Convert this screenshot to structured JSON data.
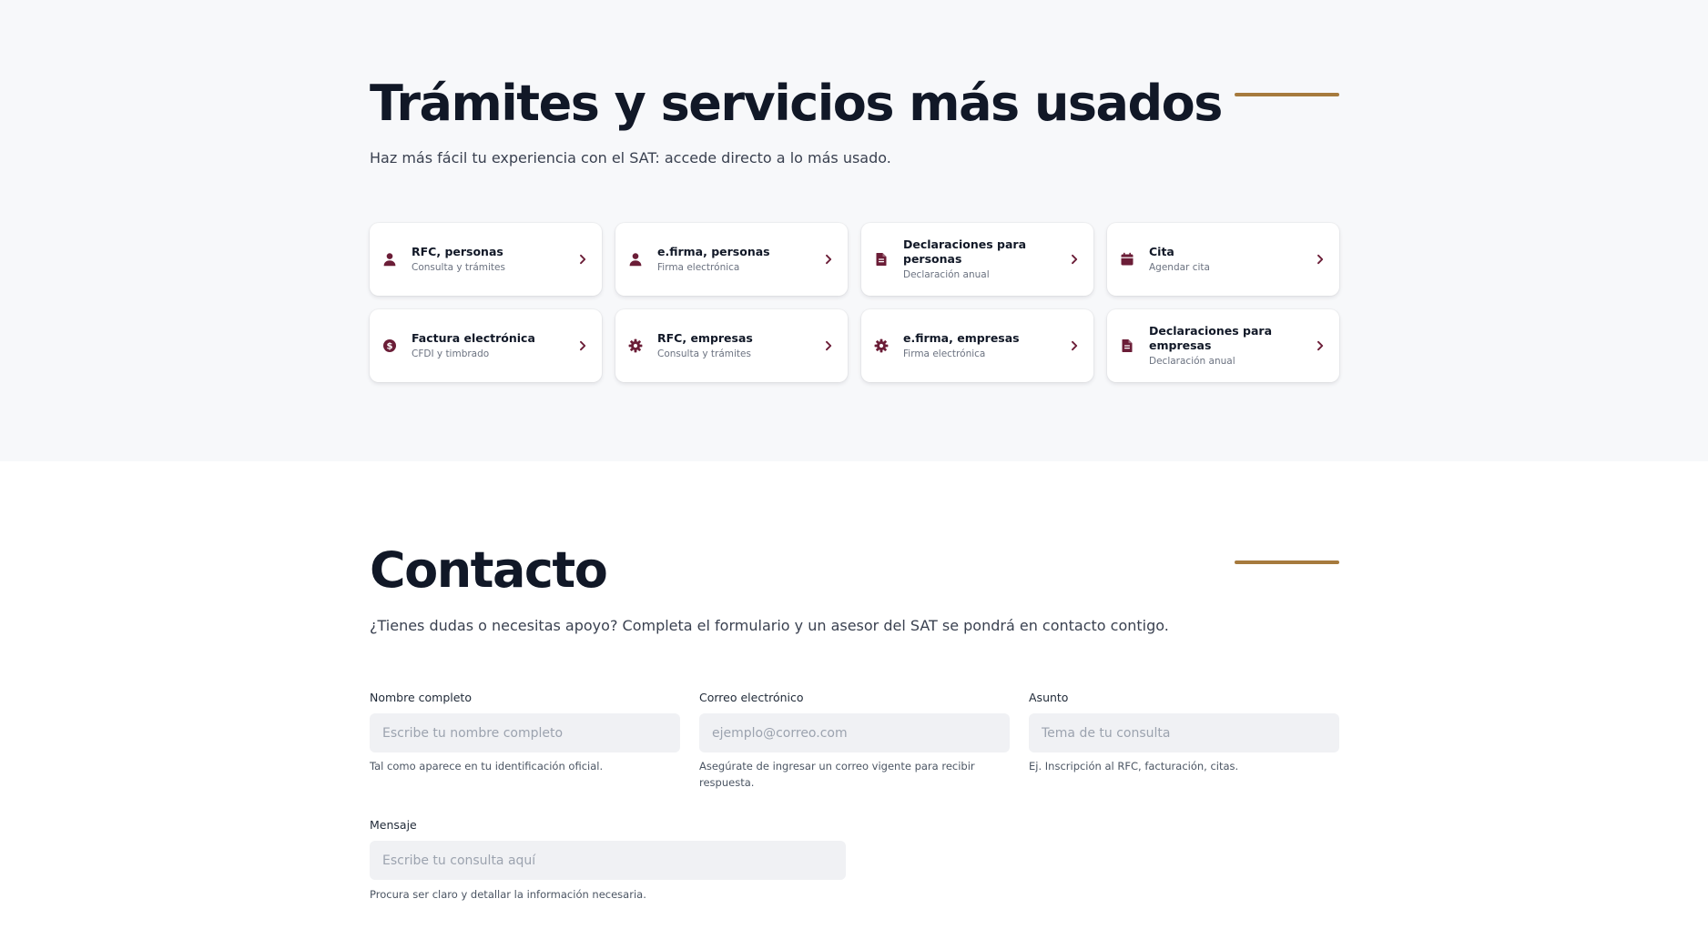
{
  "services": {
    "title": "Trámites y servicios más usados",
    "subtitle": "Haz más fácil tu experiencia con el SAT: accede directo a lo más usado.",
    "cards": [
      {
        "title": "RFC, personas",
        "subtitle": "Consulta y trámites",
        "icon": "person-icon"
      },
      {
        "title": "e.firma, personas",
        "subtitle": "Firma electrónica",
        "icon": "person-icon"
      },
      {
        "title": "Declaraciones para personas",
        "subtitle": "Declaración anual",
        "icon": "document-icon"
      },
      {
        "title": "Cita",
        "subtitle": "Agendar cita",
        "icon": "calendar-icon"
      },
      {
        "title": "Factura electrónica",
        "subtitle": "CFDI y timbrado",
        "icon": "dollar-circle-icon"
      },
      {
        "title": "RFC, empresas",
        "subtitle": "Consulta y trámites",
        "icon": "gear-icon"
      },
      {
        "title": "e.firma, empresas",
        "subtitle": "Firma electrónica",
        "icon": "gear-icon"
      },
      {
        "title": "Declaraciones para empresas",
        "subtitle": "Declaración anual",
        "icon": "document-icon"
      }
    ]
  },
  "contact": {
    "title": "Contacto",
    "subtitle": "¿Tienes dudas o necesitas apoyo? Completa el formulario y un asesor del SAT se pondrá en contacto contigo.",
    "fields": {
      "name": {
        "label": "Nombre completo",
        "placeholder": "Escribe tu nombre completo",
        "value": "",
        "help": "Tal como aparece en tu identificación oficial."
      },
      "email": {
        "label": "Correo electrónico",
        "placeholder": "ejemplo@correo.com",
        "value": "",
        "help": "Asegúrate de ingresar un correo vigente para recibir respuesta."
      },
      "subject": {
        "label": "Asunto",
        "placeholder": "Tema de tu consulta",
        "value": "",
        "help": "Ej. Inscripción al RFC, facturación, citas."
      },
      "message": {
        "label": "Mensaje",
        "placeholder": "Escribe tu consulta aquí",
        "value": "",
        "help": "Procura ser claro y detallar la información necesaria."
      }
    }
  },
  "colors": {
    "accent_line": "#a67a3d",
    "icon": "#6b1d37",
    "heading": "#111827",
    "section_bg": "#f7f8fa",
    "input_bg": "#f0f1f4"
  }
}
